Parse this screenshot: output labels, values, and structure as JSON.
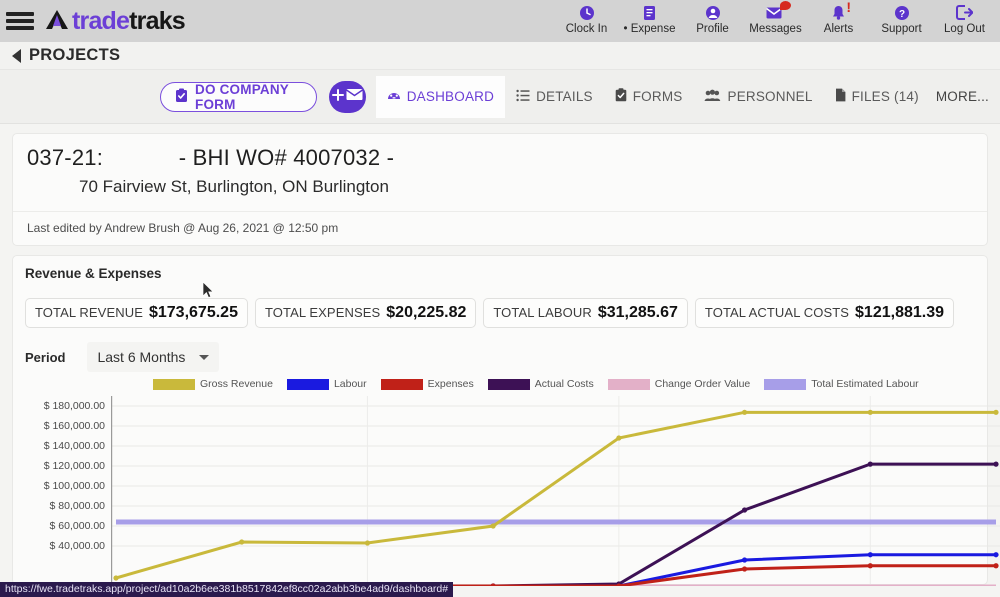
{
  "brand": {
    "name_purple": "trade",
    "name_dark": "traks",
    "mark": "A",
    "accent": "#6c3fd6"
  },
  "topnav": [
    {
      "label": "Clock In",
      "icon": "clock-icon",
      "badge": ""
    },
    {
      "label": "• Expense",
      "icon": "receipt-icon",
      "badge": ""
    },
    {
      "label": "Profile",
      "icon": "user-icon",
      "badge": ""
    },
    {
      "label": "Messages",
      "icon": "envelope-icon",
      "badge": "dot"
    },
    {
      "label": "Alerts",
      "icon": "bell-icon",
      "badge": "exclamation"
    },
    {
      "label": "Support",
      "icon": "question-circle-icon",
      "badge": ""
    },
    {
      "label": "Log Out",
      "icon": "logout-icon",
      "badge": ""
    }
  ],
  "breadcrumb": {
    "label": "PROJECTS"
  },
  "toolbar": {
    "company_form_label": "DO COMPANY FORM",
    "mail_button_label": "+"
  },
  "tabs": [
    {
      "label": "DASHBOARD",
      "icon": "speedometer-icon",
      "active": true
    },
    {
      "label": "DETAILS",
      "icon": "list-icon",
      "active": false
    },
    {
      "label": "FORMS",
      "icon": "clipboard-icon",
      "active": false
    },
    {
      "label": "PERSONNEL",
      "icon": "people-icon",
      "active": false
    },
    {
      "label": "FILES (14)",
      "icon": "file-icon",
      "active": false
    },
    {
      "label": "MORE...",
      "icon": "",
      "active": false
    }
  ],
  "project": {
    "number": "037-21:",
    "wo": "- BHI WO# 4007032 -",
    "title_line": "037-21:            - BHI WO# 4007032 -",
    "address": "70 Fairview St, Burlington, ON Burlington",
    "last_edited": "Last edited by Andrew Brush @ Aug 26, 2021 @ 12:50 pm"
  },
  "revenue": {
    "section_title": "Revenue & Expenses",
    "totals": [
      {
        "key": "TOTAL REVENUE",
        "value": "$173,675.25"
      },
      {
        "key": "TOTAL EXPENSES",
        "value": "$20,225.82"
      },
      {
        "key": "TOTAL LABOUR",
        "value": "$31,285.67"
      },
      {
        "key": "TOTAL ACTUAL COSTS",
        "value": "$121,881.39"
      }
    ],
    "period_label": "Period",
    "period_value": "Last 6 Months"
  },
  "chart_data": {
    "type": "line",
    "title": "Revenue & Expenses",
    "xlabel": "",
    "ylabel": "",
    "ylim": [
      0,
      190000
    ],
    "grid": true,
    "legend_position": "top",
    "ytick_labels": [
      "$ 180,000.00",
      "$ 160,000.00",
      "$ 140,000.00",
      "$ 120,000.00",
      "$ 100,000.00",
      "$ 80,000.00",
      "$ 60,000.00",
      "$ 40,000.00"
    ],
    "yticks": [
      180000,
      160000,
      140000,
      120000,
      100000,
      80000,
      60000,
      40000
    ],
    "x": [
      0,
      1,
      2,
      3,
      4,
      5,
      6,
      7
    ],
    "series": [
      {
        "name": "Gross Revenue",
        "color": "#c9b93b",
        "values": [
          8000,
          44000,
          43000,
          60000,
          148000,
          173675,
          173675,
          173675
        ]
      },
      {
        "name": "Labour",
        "color": "#1a1ae0",
        "values": [
          0,
          0,
          0,
          0,
          0,
          26000,
          31286,
          31286
        ]
      },
      {
        "name": "Expenses",
        "color": "#c02118",
        "values": [
          0,
          0,
          0,
          0,
          0,
          17000,
          20226,
          20226
        ]
      },
      {
        "name": "Actual Costs",
        "color": "#3d1155",
        "values": [
          0,
          0,
          0,
          0,
          2000,
          76000,
          121881,
          121881
        ]
      },
      {
        "name": "Change Order Value",
        "color": "#e3b0c8",
        "values": [
          0,
          0,
          0,
          0,
          0,
          0,
          0,
          0
        ]
      },
      {
        "name": "Total Estimated Labour",
        "color": "#a79ee8",
        "values": [
          64000,
          64000,
          64000,
          64000,
          64000,
          64000,
          64000,
          64000
        ]
      }
    ],
    "legend": [
      {
        "label": "Gross Revenue",
        "color": "#c9b93b"
      },
      {
        "label": "Labour",
        "color": "#1a1ae0"
      },
      {
        "label": "Expenses",
        "color": "#c02118"
      },
      {
        "label": "Actual Costs",
        "color": "#3d1155"
      },
      {
        "label": "Change Order Value",
        "color": "#e3b0c8"
      },
      {
        "label": "Total Estimated Labour",
        "color": "#a79ee8"
      }
    ]
  },
  "statusbar": {
    "url": "https://fwe.tradetraks.app/project/ad10a2b6ee381b8517842ef8cc02a2abb3be4ad9/dashboard#"
  }
}
